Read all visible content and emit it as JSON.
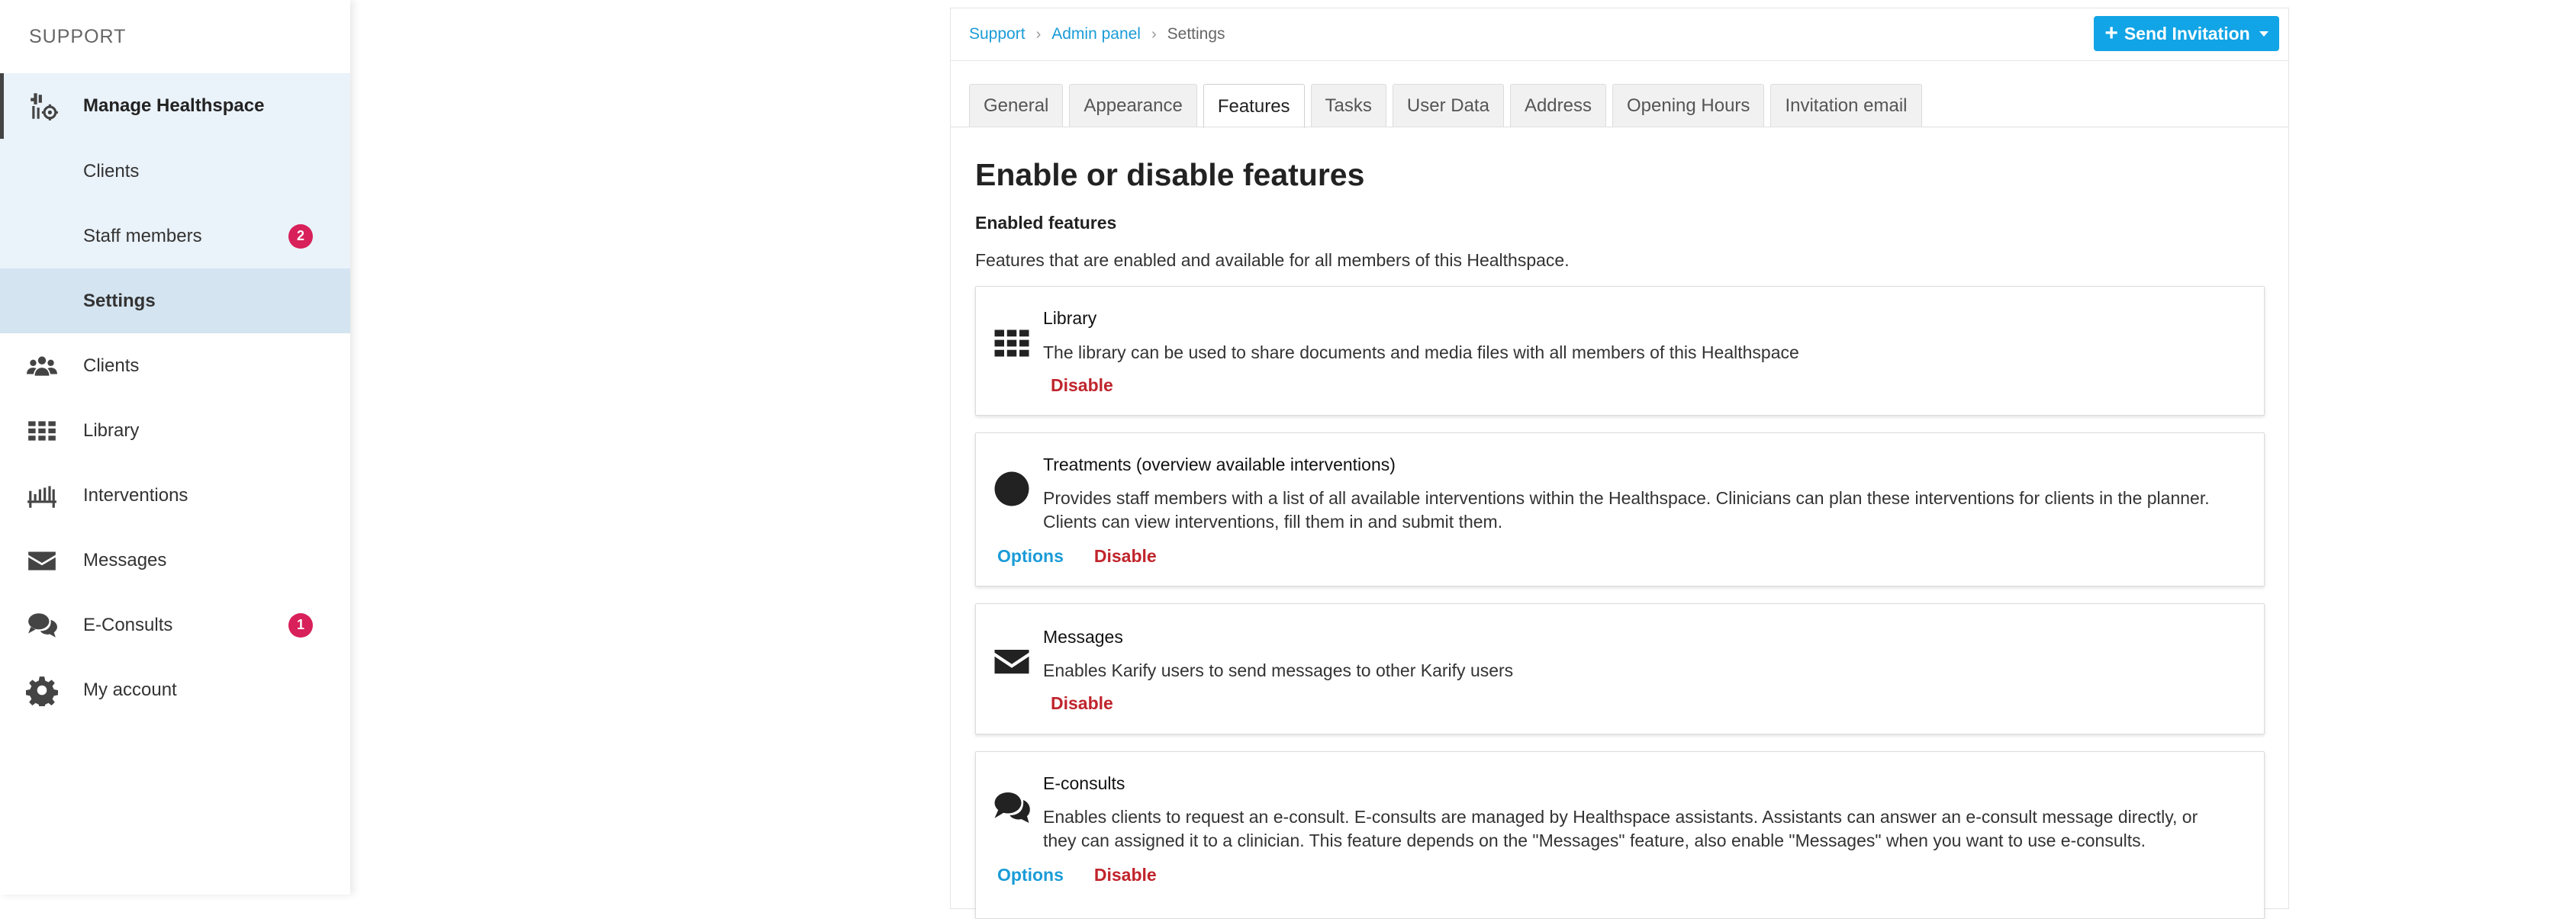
{
  "sidebar": {
    "section_label": "SUPPORT",
    "parent": {
      "label": "Manage Healthspace",
      "icon": "manage-healthspace-icon"
    },
    "sub_items": [
      {
        "label": "Clients",
        "active": false,
        "badge": null
      },
      {
        "label": "Staff members",
        "active": false,
        "badge": "2"
      },
      {
        "label": "Settings",
        "active": true,
        "badge": null
      }
    ],
    "items": [
      {
        "label": "Clients",
        "icon": "users-icon",
        "badge": null
      },
      {
        "label": "Library",
        "icon": "grid-icon",
        "badge": null
      },
      {
        "label": "Interventions",
        "icon": "interventions-icon",
        "badge": null
      },
      {
        "label": "Messages",
        "icon": "envelope-icon",
        "badge": null
      },
      {
        "label": "E-Consults",
        "icon": "chat-icon",
        "badge": "1"
      },
      {
        "label": "My account",
        "icon": "gear-icon",
        "badge": null
      }
    ]
  },
  "breadcrumb": [
    "Support",
    "Admin panel",
    "Settings"
  ],
  "send_invitation_label": "Send Invitation",
  "tabs": [
    "General",
    "Appearance",
    "Features",
    "Tasks",
    "User Data",
    "Address",
    "Opening Hours",
    "Invitation email"
  ],
  "active_tab": "Features",
  "page_title": "Enable or disable features",
  "enabled_section": {
    "title": "Enabled features",
    "description": "Features that are enabled and available for all members of this Healthspace."
  },
  "features": [
    {
      "title": "Library",
      "icon": "grid-icon",
      "description": "The library can be used to share documents and media files with all members of this Healthspace",
      "options_label": null,
      "disable_label": "Disable"
    },
    {
      "title": "Treatments (overview available interventions)",
      "icon": "circle-icon",
      "description_lines": [
        "Provides staff members with a list of all available interventions within the Healthspace. Clinicians can plan these interventions for clients in the planner.",
        "Clients can view interventions, fill them in and submit them."
      ],
      "options_label": "Options",
      "disable_label": "Disable"
    },
    {
      "title": "Messages",
      "icon": "envelope-icon",
      "description": "Enables Karify users to send messages to other Karify users",
      "options_label": null,
      "disable_label": "Disable"
    },
    {
      "title": "E-consults",
      "icon": "chat-icon",
      "description_lines": [
        "Enables clients to request an e-consult. E-consults are managed by Healthspace assistants. Assistants can answer an e-consult message directly, or",
        "they can assigned it to a clinician. This feature depends on the \"Messages\" feature, also enable \"Messages\" when you want to use e-consults."
      ],
      "options_label": "Options",
      "disable_label": "Disable"
    }
  ],
  "colors": {
    "accent": "#11a4e6",
    "link": "#1a9bd7",
    "danger": "#c0242c",
    "badge": "#d8205a",
    "sidebar_group": "#eaf2fa",
    "sidebar_active": "#d4e4f1"
  }
}
